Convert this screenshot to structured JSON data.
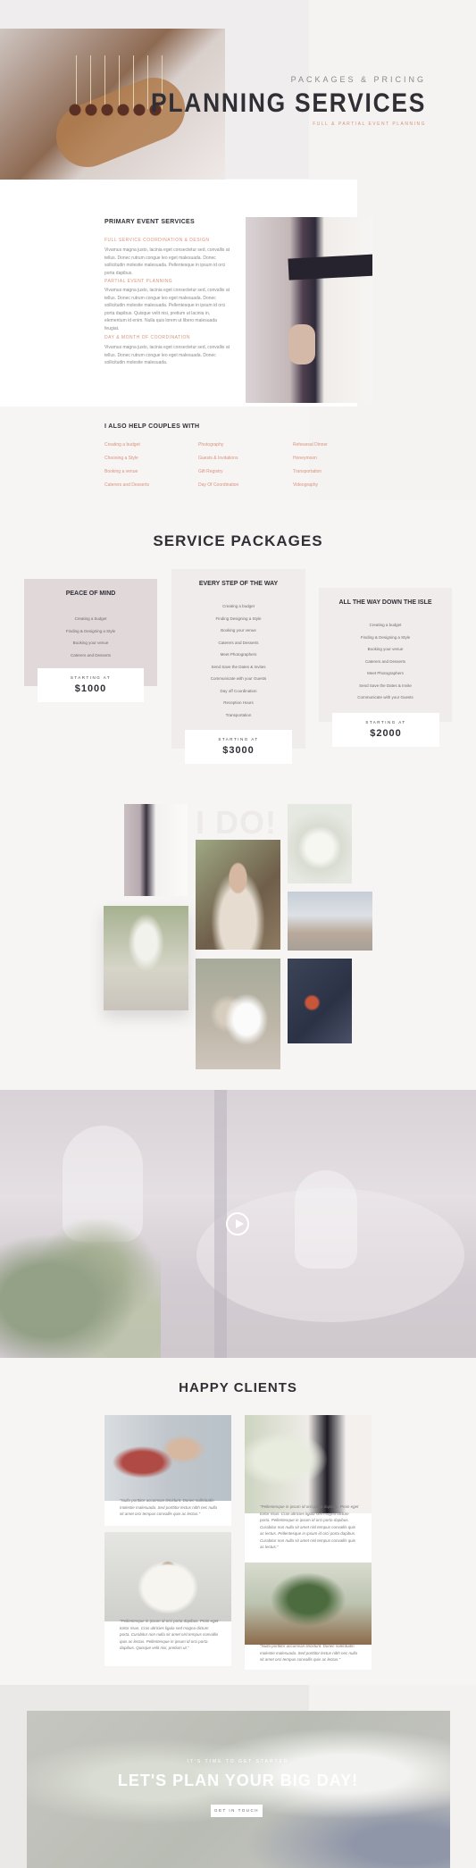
{
  "hero": {
    "kicker": "PACKAGES & PRICING",
    "title": "PLANNING SERVICES",
    "subtitle": "FULL & PARTIAL EVENT PLANNING"
  },
  "services": {
    "heading": "PRIMARY EVENT SERVICES",
    "items": [
      {
        "title": "FULL SERVICE COORDINATION & DESIGN",
        "text": "Vivamus magna justo, lacinia eget consectetur sed, convallis at tellus. Donec rutrum congue leo eget malesuada. Donec sollicitudin molestie malesuada. Pellentesque in ipsum id orci porta dapibus."
      },
      {
        "title": "PARTIAL EVENT PLANNING",
        "text": "Vivamus magna justo, lacinia eget consectetur sed, convallis at tellus. Donec rutrum congue leo eget malesuada. Donec sollicitudin molestie malesuada. Pellentesque in ipsum id orci porta dapibus. Quisque velit nisi, pretium ut lacinia in, elementum id enim. Nulla quis lorem ut libero malesuada feugiat."
      },
      {
        "title": "DAY & MONTH OF COORDINATION",
        "text": "Vivamus magna justo, lacinia eget consectetur sed, convallis at tellus. Donec rutrum congue leo eget malesuada. Donec sollicitudin molestie malesuada."
      }
    ]
  },
  "help": {
    "heading": "I ALSO HELP COUPLES WITH",
    "col1": [
      "Creating a budget",
      "Choosing a Style",
      "Booking a venue",
      "Caterers and Desserts"
    ],
    "col2": [
      "Photography",
      "Guests & Invitations",
      "Gift Registry",
      "Day Of Coordination"
    ],
    "col3": [
      "Rehearsal Dinner",
      "Honeymoon",
      "Transportation",
      "Videography"
    ]
  },
  "packages": {
    "title": "SERVICE PACKAGES",
    "starting_label": "STARTING AT",
    "list": [
      {
        "name": "PEACE OF MIND",
        "items": [
          "Creating a budget",
          "Finding & Designing a Style",
          "Booking your venue",
          "Caterers and Desserts"
        ],
        "price": "$1000"
      },
      {
        "name": "EVERY STEP OF THE WAY",
        "items": [
          "Creating a budget",
          "Finding Designing a Style",
          "Booking your venue",
          "Caterers and Desserts",
          "Meet Photographers",
          "Send Save the Dates & Invites",
          "Communicate with your Guests",
          "Day off Coordination",
          "Reception Hours",
          "Transportation"
        ],
        "price": "$3000"
      },
      {
        "name": "ALL THE WAY DOWN THE ISLE",
        "items": [
          "Creating a budget",
          "Finding & Designing a Style",
          "Booking your venue",
          "Caterers and Desserts",
          "Meet Photographers",
          "Send Save the Dates & Invite",
          "Communicate with your Guests"
        ],
        "price": "$2000"
      }
    ]
  },
  "gallery": {
    "watermark": "I DO!"
  },
  "testimonials": {
    "title": "HAPPY CLIENTS",
    "quotes": [
      "\"Nulla porttitor accumsan tincidunt. Donec sollicitudin molestie malesuada. Sed porttitor lectus nibh nec nulla sit amet orci tempus convallis quis ac lectus.\"",
      "\"Pellentesque in ipsum id orci porta dapibus. Proin eget tortor risus. Cras ultricies ligula sed magna dictum porta. Pellentesque in ipsum id orci porta dapibus. Curabitur non nulla sit amet nisl tempus convallis quis ac lectus. Pellentesque in ipsum id orci porta dapibus. Curabitur non nulla sit amet nisl tempus convallis quis ac lectus.\"",
      "\"Pellentesque in ipsum id orci porta dapibus. Proin eget tortor risus. Cras ultricies ligula sed magna dictum porta. Curabitur non nulla sit amet nisl tempus convallis quis ac lectus. Pellentesque in ipsum id orci porta dapibus. Quisque velit nisi, pretium ut.\"",
      "\"Nulla porttitor accumsan tincidunt. Donec sollicitudin molestie malesuada. Sed porttitor lectus nibh nec nulla sit amet orci tempus convallis quis ac lectus.\""
    ]
  },
  "cta": {
    "kicker": "IT'S TIME TO GET STARTED",
    "title": "LET'S PLAN YOUR BIG DAY!",
    "button": "GET IN TOUCH"
  },
  "colors": {
    "accent": "#d8937c",
    "heading": "#2f2f35",
    "card": "#f1ecec"
  }
}
